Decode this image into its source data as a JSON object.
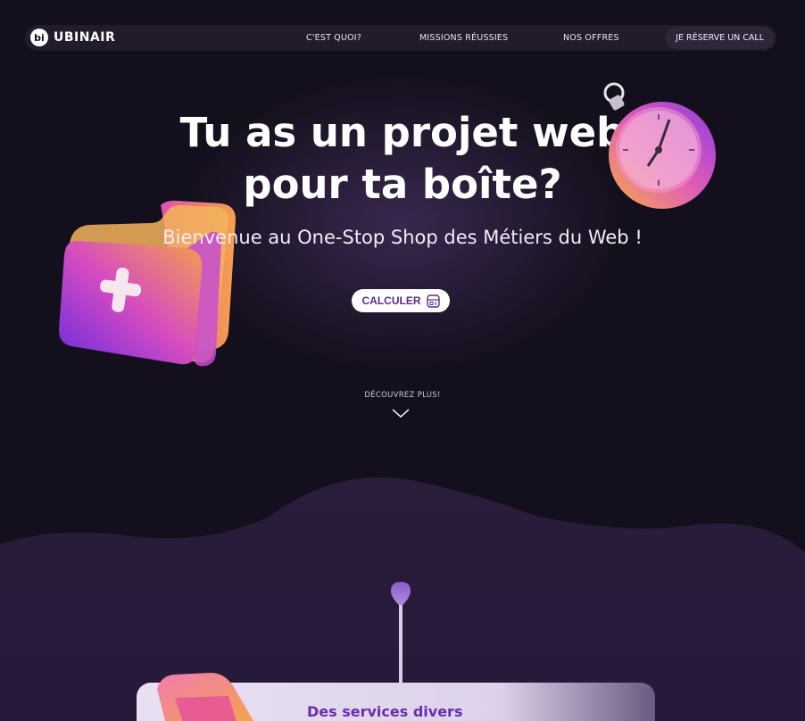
{
  "brand": {
    "logo_mark": "bi",
    "name": "UBINAIR"
  },
  "nav": {
    "links": [
      "C'EST QUOI?",
      "MISSIONS RÉUSSIES",
      "NOS OFFRES"
    ],
    "cta": "JE RÉSERVE UN CALL"
  },
  "hero": {
    "title_line1": "Tu as un projet web",
    "title_line2": "pour ta boîte?",
    "subtitle": "Bienvenue au One-Stop Shop des Métiers du Web !",
    "button": "CALCULER",
    "discover": "DÉCOUVREZ PLUS!"
  },
  "services": {
    "card_title": "Des services divers"
  },
  "colors": {
    "background": "#140f1c",
    "wave": "#2a1d3a",
    "accent": "#5b2a8c",
    "card_title": "#6a2fa8"
  },
  "icons": [
    "folder-plus-illustration",
    "stopwatch-illustration",
    "calculator-icon",
    "chevron-down-icon",
    "pin-marker-icon"
  ]
}
